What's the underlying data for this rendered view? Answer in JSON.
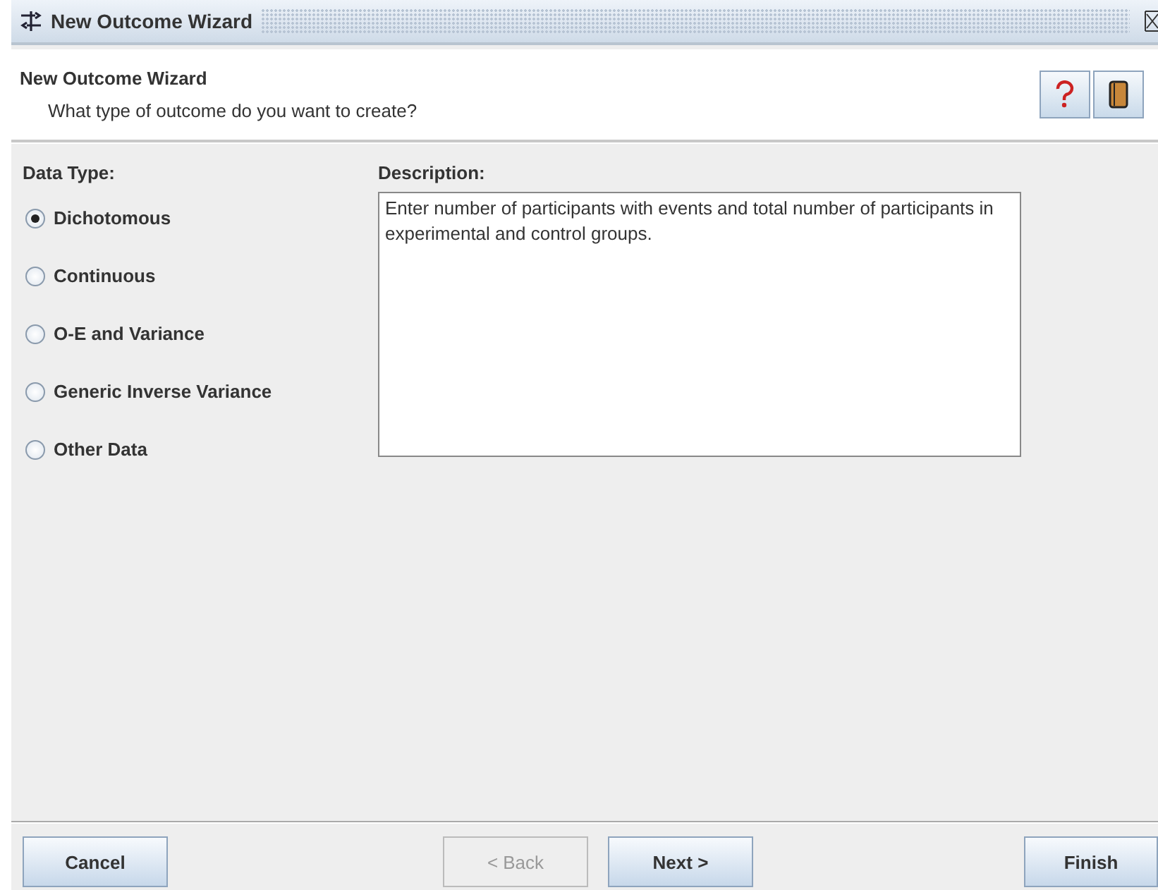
{
  "window": {
    "title": "New Outcome Wizard"
  },
  "header": {
    "title": "New Outcome Wizard",
    "subtitle": "What type of outcome do you want to create?"
  },
  "data_type": {
    "label": "Data Type:",
    "options": [
      {
        "label": "Dichotomous",
        "selected": true
      },
      {
        "label": "Continuous",
        "selected": false
      },
      {
        "label": "O-E and Variance",
        "selected": false
      },
      {
        "label": "Generic Inverse Variance",
        "selected": false
      },
      {
        "label": "Other Data",
        "selected": false
      }
    ]
  },
  "description": {
    "label": "Description:",
    "text": "Enter number of participants with events and total number of participants in experimental and control groups."
  },
  "buttons": {
    "left": [
      {
        "label": "Cancel",
        "disabled": false
      }
    ],
    "center": [
      {
        "label": "< Back",
        "disabled": true
      },
      {
        "label": "Next >",
        "disabled": false
      }
    ],
    "right": [
      {
        "label": "Finish",
        "disabled": false
      }
    ]
  }
}
